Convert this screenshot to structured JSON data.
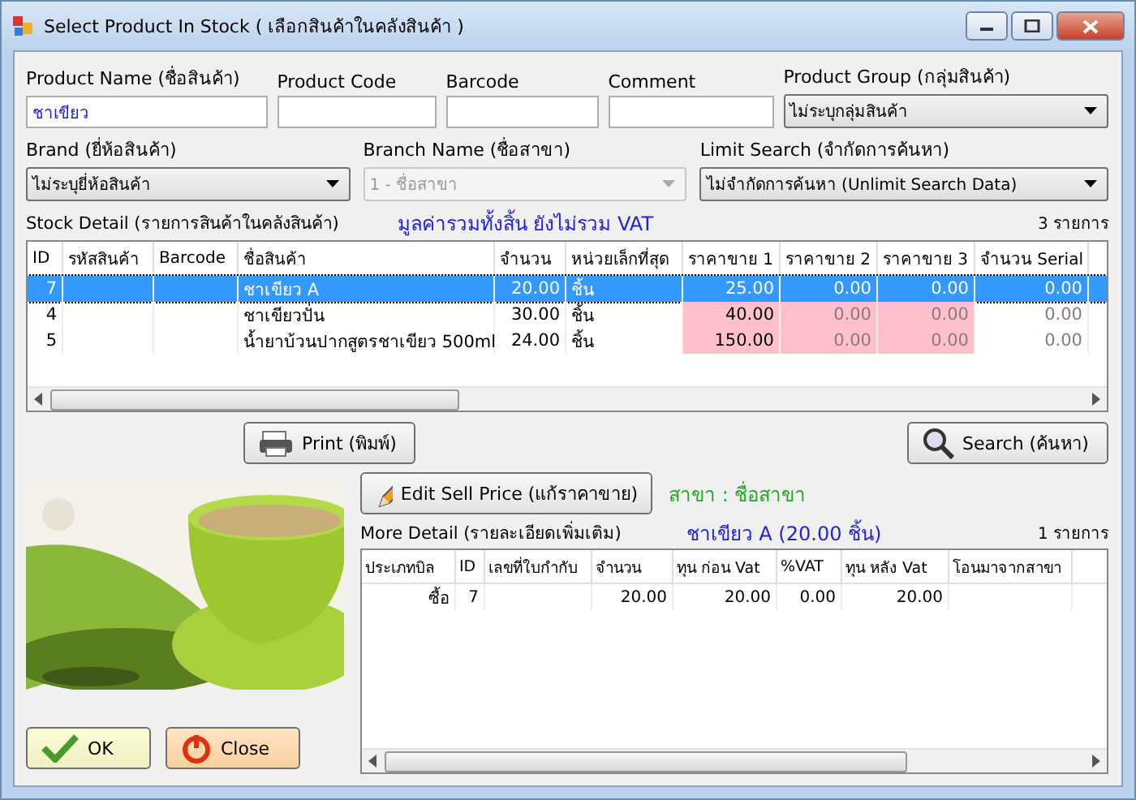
{
  "window": {
    "title": "Select Product In Stock ( เลือกสินค้าในคลังสินค้า )"
  },
  "filters_row1": [
    {
      "kind": "text",
      "label": "Product Name (ชื่อสินค้า)",
      "value": "ชาเขียว"
    },
    {
      "kind": "text",
      "label": "Product Code"
    },
    {
      "kind": "text",
      "label": "Barcode"
    },
    {
      "kind": "text",
      "label": "Comment"
    },
    {
      "kind": "combo",
      "label": "Product Group (กลุ่มสินค้า)",
      "value": "ไม่ระบุกลุ่มสินค้า",
      "disabled": false
    }
  ],
  "filters_row2": [
    {
      "kind": "combo",
      "label": "Brand (ยี่ห้อสินค้า)",
      "value": "ไม่ระบุยี่ห้อสินค้า",
      "disabled": false
    },
    {
      "kind": "combo",
      "label": "Branch Name (ชื่อสาขา)",
      "value": "1 - ชื่อสาขา",
      "disabled": true
    },
    {
      "kind": "combo",
      "label": "Limit Search (จำกัดการค้นหา)",
      "value": "ไม่จำกัดการค้นหา (Unlimit Search Data)",
      "disabled": false
    }
  ],
  "stock": {
    "title": "Stock Detail (รายการสินค้าในคลังสินค้า)",
    "note": "มูลค่ารวมทั้งสิ้น ยังไม่รวม VAT",
    "count": "3 รายการ",
    "columns": [
      {
        "label": "ID",
        "kind": "num"
      },
      {
        "label": "รหัสสินค้า",
        "kind": "text"
      },
      {
        "label": "Barcode",
        "kind": "text"
      },
      {
        "label": "ชื่อสินค้า",
        "kind": "text"
      },
      {
        "label": "จำนวน",
        "kind": "num"
      },
      {
        "label": "หน่วยเล็กที่สุด",
        "kind": "text"
      },
      {
        "label": "ราคาขาย 1",
        "kind": "price"
      },
      {
        "label": "ราคาขาย 2",
        "kind": "price"
      },
      {
        "label": "ราคาขาย 3",
        "kind": "price"
      },
      {
        "label": "จำนวน Serial",
        "kind": "num"
      }
    ],
    "rows": [
      {
        "selected": true,
        "cells": [
          "7",
          "",
          "",
          "ชาเขียว A",
          "20.00",
          "ชิ้น",
          "25.00",
          "0.00",
          "0.00",
          "0.00"
        ]
      },
      {
        "selected": false,
        "cells": [
          "4",
          "",
          "",
          "ชาเขียวปั่น",
          "30.00",
          "ชิ้น",
          "40.00",
          "0.00",
          "0.00",
          "0.00"
        ]
      },
      {
        "selected": false,
        "cells": [
          "5",
          "",
          "",
          "น้ำยาบ้วนปากสูตรชาเขียว  500ml",
          "24.00",
          "ชิ้น",
          "150.00",
          "0.00",
          "0.00",
          "0.00"
        ]
      }
    ]
  },
  "print_button": "Print (พิมพ์)",
  "search_button": "Search (ค้นหา)",
  "edit_price_button": "Edit Sell Price (แก้ราคาขาย)",
  "branch_label": "สาขา : ชื่อสาขา",
  "more": {
    "title": "More Detail (รายละเอียดเพิ่มเติม)",
    "product": "ชาเขียว A (20.00 ชิ้น)",
    "count": "1 รายการ",
    "columns": [
      "ประเภทบิล",
      "ID",
      "เลขที่ใบกำกับ",
      "จำนวน",
      "ทุน ก่อน Vat",
      "%VAT",
      "ทุน หลัง Vat",
      "โอนมาจากสาขา"
    ],
    "rows": [
      [
        "ซื้อ",
        "7",
        "",
        "20.00",
        "20.00",
        "0.00",
        "20.00",
        ""
      ]
    ]
  },
  "ok_button": "OK",
  "close_button": "Close"
}
